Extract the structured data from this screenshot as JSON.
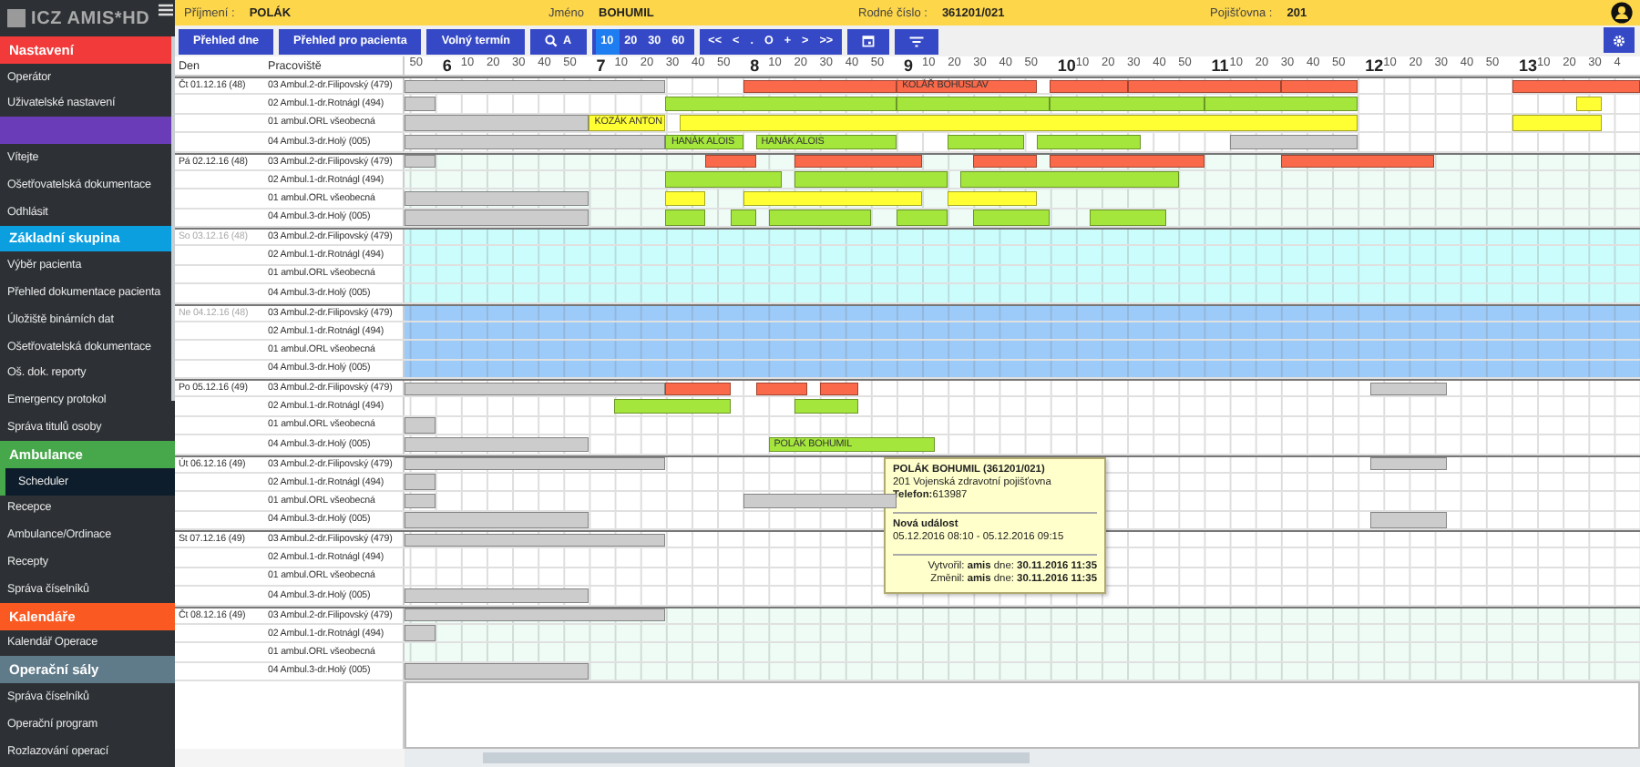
{
  "logo": {
    "text": "ICZ AMIS*HD"
  },
  "sidebar": {
    "items": [
      {
        "kind": "section",
        "label": "Nastavení",
        "color": "#f23a3a"
      },
      {
        "kind": "item",
        "label": "Operátor",
        "selected": false
      },
      {
        "kind": "item",
        "label": "Uživatelské nastavení",
        "selected": false
      },
      {
        "kind": "section",
        "color": "#6a3cb8"
      },
      {
        "kind": "item",
        "label": "Vítejte",
        "selected": false
      },
      {
        "kind": "item",
        "label": "Ošetřovatelská dokumentace",
        "selected": false
      },
      {
        "kind": "item",
        "label": "Odhlásit",
        "selected": false
      },
      {
        "kind": "section",
        "label": "Základní skupina",
        "color": "#0b9fe0"
      },
      {
        "kind": "item",
        "label": "Výběr pacienta",
        "selected": false
      },
      {
        "kind": "item",
        "label": "Přehled dokumentace pacienta",
        "selected": false
      },
      {
        "kind": "item",
        "label": "Úložiště binárních dat",
        "selected": false
      },
      {
        "kind": "item",
        "label": "Ošetřovatelská dokumentace",
        "selected": false
      },
      {
        "kind": "item",
        "label": "Oš. dok. reporty",
        "selected": false
      },
      {
        "kind": "item",
        "label": "Emergency protokol",
        "selected": false
      },
      {
        "kind": "item",
        "label": "Správa titulů osoby",
        "selected": false
      },
      {
        "kind": "section",
        "label": "Ambulance",
        "color": "#46a84a"
      },
      {
        "kind": "item",
        "label": "Scheduler",
        "selected": true
      },
      {
        "kind": "item",
        "label": "Recepce",
        "selected": false
      },
      {
        "kind": "item",
        "label": "Ambulance/Ordinace",
        "selected": false
      },
      {
        "kind": "item",
        "label": "Recepty",
        "selected": false
      },
      {
        "kind": "item",
        "label": "Správa číselníků",
        "selected": false
      },
      {
        "kind": "section",
        "label": "Kalendáře",
        "color": "#fa5a22"
      },
      {
        "kind": "item",
        "label": "Kalendář Operace",
        "selected": false
      },
      {
        "kind": "section",
        "label": "Operační sály",
        "color": "#5f7b8a"
      },
      {
        "kind": "item",
        "label": "Správa číselníků",
        "selected": false
      },
      {
        "kind": "item",
        "label": "Operační program",
        "selected": false
      },
      {
        "kind": "item",
        "label": "Rozlazování operací",
        "selected": false
      }
    ]
  },
  "patient": [
    {
      "label": "Příjmení :",
      "value": "POLÁK"
    },
    {
      "label": "Jméno",
      "value": "BOHUMIL"
    },
    {
      "label": "Rodné číslo :",
      "value": "361201/021"
    },
    {
      "label": "Pojišťovna :",
      "value": "201"
    }
  ],
  "toolbar": [
    {
      "kind": "text",
      "label": "Přehled dne"
    },
    {
      "kind": "text",
      "label": "Přehled pro pacienta"
    },
    {
      "kind": "text",
      "label": "Volný termín"
    },
    {
      "kind": "search",
      "label": "A"
    },
    {
      "kind": "segment",
      "options": [
        {
          "label": "10",
          "selected": true
        },
        {
          "label": "20",
          "selected": false
        },
        {
          "label": "30",
          "selected": false
        },
        {
          "label": "60",
          "selected": false
        }
      ]
    },
    {
      "kind": "nav",
      "labels": [
        "<<",
        "<",
        ".",
        "O",
        "+",
        ">",
        ">>"
      ]
    },
    {
      "kind": "calendar"
    },
    {
      "kind": "filter"
    }
  ],
  "table": {
    "columns": [
      "Den",
      "Pracoviště"
    ],
    "time_header": [
      {
        "text": "50",
        "kind": "minute"
      },
      {
        "text": "6",
        "kind": "hour"
      },
      {
        "text": "10",
        "kind": "minute"
      },
      {
        "text": "20",
        "kind": "minute"
      },
      {
        "text": "30",
        "kind": "minute"
      },
      {
        "text": "40",
        "kind": "minute"
      },
      {
        "text": "50",
        "kind": "minute"
      },
      {
        "text": "7",
        "kind": "hour"
      },
      {
        "text": "10",
        "kind": "minute"
      },
      {
        "text": "20",
        "kind": "minute"
      },
      {
        "text": "30",
        "kind": "minute"
      },
      {
        "text": "40",
        "kind": "minute"
      },
      {
        "text": "50",
        "kind": "minute"
      },
      {
        "text": "8",
        "kind": "hour"
      },
      {
        "text": "10",
        "kind": "minute"
      },
      {
        "text": "20",
        "kind": "minute"
      },
      {
        "text": "30",
        "kind": "minute"
      },
      {
        "text": "40",
        "kind": "minute"
      },
      {
        "text": "50",
        "kind": "minute"
      },
      {
        "text": "9",
        "kind": "hour"
      },
      {
        "text": "10",
        "kind": "minute"
      },
      {
        "text": "20",
        "kind": "minute"
      },
      {
        "text": "30",
        "kind": "minute"
      },
      {
        "text": "40",
        "kind": "minute"
      },
      {
        "text": "50",
        "kind": "minute"
      },
      {
        "text": "10",
        "kind": "hour"
      },
      {
        "text": "10",
        "kind": "minute"
      },
      {
        "text": "20",
        "kind": "minute"
      },
      {
        "text": "30",
        "kind": "minute"
      },
      {
        "text": "40",
        "kind": "minute"
      },
      {
        "text": "50",
        "kind": "minute"
      },
      {
        "text": "11",
        "kind": "hour"
      },
      {
        "text": "10",
        "kind": "minute"
      },
      {
        "text": "20",
        "kind": "minute"
      },
      {
        "text": "30",
        "kind": "minute"
      },
      {
        "text": "40",
        "kind": "minute"
      },
      {
        "text": "50",
        "kind": "minute"
      },
      {
        "text": "12",
        "kind": "hour"
      },
      {
        "text": "10",
        "kind": "minute"
      },
      {
        "text": "20",
        "kind": "minute"
      },
      {
        "text": "30",
        "kind": "minute"
      },
      {
        "text": "40",
        "kind": "minute"
      },
      {
        "text": "50",
        "kind": "minute"
      },
      {
        "text": "13",
        "kind": "hour"
      },
      {
        "text": "10",
        "kind": "minute"
      },
      {
        "text": "20",
        "kind": "minute"
      },
      {
        "text": "30",
        "kind": "minute"
      },
      {
        "text": "4",
        "kind": "minute"
      }
    ],
    "days": [
      {
        "date": "Čt 01.12.16 (48)",
        "kind": "weekday",
        "rows": [
          {
            "workplace": "03 Ambul.2-dr.Filipovský (479)",
            "events": [
              {
                "color": "#cccccc"
              },
              {
                "color": "#f9694a"
              },
              {
                "color": "#f9694a",
                "label": "KOLÁŘ BOHUSLAV"
              },
              {
                "color": "#f9694a"
              },
              {
                "color": "#f9694a"
              },
              {
                "color": "#f9694a"
              },
              {
                "color": "#f9694a"
              }
            ]
          },
          {
            "workplace": "02 Ambul.1-dr.Rotnágl (494)",
            "events": [
              {
                "color": "#cccccc"
              },
              {
                "color": "#a4e63c"
              },
              {
                "color": "#a4e63c"
              },
              {
                "color": "#a4e63c"
              },
              {
                "color": "#a4e63c"
              },
              {
                "color": "#ffff33"
              }
            ]
          },
          {
            "workplace": "01 ambul.ORL všeobecná",
            "events": [
              {
                "color": "#cccccc"
              },
              {
                "color": "#ffff33",
                "label": "KOZÁK ANTON"
              },
              {
                "color": "#ffff33"
              },
              {
                "color": "#ffff33"
              }
            ]
          },
          {
            "workplace": "04 Ambul.3-dr.Holý (005)",
            "events": [
              {
                "color": "#cccccc"
              },
              {
                "color": "#a4e63c",
                "label": "HANÁK ALOIS"
              },
              {
                "color": "#a4e63c",
                "label": "HANÁK ALOIS"
              },
              {
                "color": "#a4e63c"
              },
              {
                "color": "#a4e63c"
              },
              {
                "color": "#cccccc"
              }
            ]
          }
        ]
      },
      {
        "date": "Pá 02.12.16 (48)",
        "kind": "highlight",
        "rows": [
          {
            "workplace": "03 Ambul.2-dr.Filipovský (479)",
            "events": [
              {
                "color": "#cccccc"
              },
              {
                "color": "#f9694a"
              },
              {
                "color": "#f9694a"
              },
              {
                "color": "#f9694a"
              },
              {
                "color": "#f9694a"
              },
              {
                "color": "#f9694a"
              }
            ]
          },
          {
            "workplace": "02 Ambul.1-dr.Rotnágl (494)",
            "events": [
              {
                "color": "#a4e63c"
              },
              {
                "color": "#a4e63c"
              },
              {
                "color": "#a4e63c"
              }
            ]
          },
          {
            "workplace": "01 ambul.ORL všeobecná",
            "events": [
              {
                "color": "#cccccc"
              },
              {
                "color": "#ffff33"
              },
              {
                "color": "#ffff33"
              },
              {
                "color": "#ffff33"
              }
            ]
          },
          {
            "workplace": "04 Ambul.3-dr.Holý (005)",
            "events": [
              {
                "color": "#cccccc"
              },
              {
                "color": "#a4e63c"
              },
              {
                "color": "#a4e63c"
              },
              {
                "color": "#a4e63c"
              },
              {
                "color": "#a4e63c"
              },
              {
                "color": "#a4e63c"
              },
              {
                "color": "#a4e63c"
              }
            ]
          }
        ]
      },
      {
        "date": "So 03.12.16 (48)",
        "kind": "saturday",
        "rows": [
          {
            "workplace": "03 Ambul.2-dr.Filipovský (479)"
          },
          {
            "workplace": "02 Ambul.1-dr.Rotnágl (494)"
          },
          {
            "workplace": "01 ambul.ORL všeobecná"
          },
          {
            "workplace": "04 Ambul.3-dr.Holý (005)"
          }
        ]
      },
      {
        "date": "Ne 04.12.16 (48)",
        "kind": "sunday",
        "rows": [
          {
            "workplace": "03 Ambul.2-dr.Filipovský (479)"
          },
          {
            "workplace": "02 Ambul.1-dr.Rotnágl (494)"
          },
          {
            "workplace": "01 ambul.ORL všeobecná"
          },
          {
            "workplace": "04 Ambul.3-dr.Holý (005)"
          }
        ]
      },
      {
        "date": "Po 05.12.16 (49)",
        "kind": "weekday",
        "rows": [
          {
            "workplace": "03 Ambul.2-dr.Filipovský (479)",
            "events": [
              {
                "color": "#cccccc"
              },
              {
                "color": "#f9694a"
              },
              {
                "color": "#f9694a"
              },
              {
                "color": "#f9694a"
              },
              {
                "color": "#cccccc"
              }
            ]
          },
          {
            "workplace": "02 Ambul.1-dr.Rotnágl (494)",
            "events": [
              {
                "color": "#a4e63c"
              },
              {
                "color": "#a4e63c"
              }
            ]
          },
          {
            "workplace": "01 ambul.ORL všeobecná",
            "events": [
              {
                "color": "#cccccc"
              }
            ]
          },
          {
            "workplace": "04 Ambul.3-dr.Holý (005)",
            "events": [
              {
                "color": "#cccccc"
              },
              {
                "color": "#a4e63c",
                "label": "POLÁK BOHUMIL"
              }
            ]
          }
        ]
      },
      {
        "date": "Út 06.12.16 (49)",
        "kind": "weekday",
        "rows": [
          {
            "workplace": "03 Ambul.2-dr.Filipovský (479)",
            "events": [
              {
                "color": "#cccccc"
              },
              {
                "color": "#cccccc"
              }
            ]
          },
          {
            "workplace": "02 Ambul.1-dr.Rotnágl (494)",
            "events": [
              {
                "color": "#cccccc"
              }
            ]
          },
          {
            "workplace": "01 ambul.ORL všeobecná",
            "events": [
              {
                "color": "#cccccc"
              },
              {
                "color": "#cccccc"
              }
            ]
          },
          {
            "workplace": "04 Ambul.3-dr.Holý (005)",
            "events": [
              {
                "color": "#cccccc"
              },
              {
                "color": "#cccccc"
              }
            ]
          }
        ]
      },
      {
        "date": "St 07.12.16 (49)",
        "kind": "weekday",
        "rows": [
          {
            "workplace": "03 Ambul.2-dr.Filipovský (479)",
            "events": [
              {
                "color": "#cccccc"
              }
            ]
          },
          {
            "workplace": "02 Ambul.1-dr.Rotnágl (494)"
          },
          {
            "workplace": "01 ambul.ORL všeobecná"
          },
          {
            "workplace": "04 Ambul.3-dr.Holý (005)",
            "events": [
              {
                "color": "#cccccc"
              }
            ]
          }
        ]
      },
      {
        "date": "Čt 08.12.16 (49)",
        "kind": "highlight",
        "rows": [
          {
            "workplace": "03 Ambul.2-dr.Filipovský (479)",
            "events": [
              {
                "color": "#cccccc"
              }
            ]
          },
          {
            "workplace": "02 Ambul.1-dr.Rotnágl (494)",
            "events": [
              {
                "color": "#cccccc"
              }
            ]
          },
          {
            "workplace": "01 ambul.ORL všeobecná"
          },
          {
            "workplace": "04 Ambul.3-dr.Holý (005)",
            "events": [
              {
                "color": "#cccccc"
              }
            ]
          }
        ]
      }
    ]
  },
  "tooltip": {
    "lines": [
      {
        "kind": "title",
        "text": "POLÁK BOHUMIL (361201/021)"
      },
      {
        "kind": "plain",
        "text": "201 Vojenská zdravotní pojišťovna"
      },
      {
        "kind": "plain",
        "text": "**Telefon:**613987"
      },
      {
        "kind": "rule"
      },
      {
        "kind": "title",
        "text": "Nová událost"
      },
      {
        "kind": "plain",
        "text": "05.12.2016 08:10 - 05.12.2016 09:15"
      },
      {
        "kind": "rule"
      },
      {
        "kind": "right",
        "text": "Vytvořil: **amis** dne: **30.11.2016 11:35**"
      },
      {
        "kind": "right",
        "text": "Změnil: **amis** dne: **30.11.2016 11:35**"
      }
    ]
  }
}
